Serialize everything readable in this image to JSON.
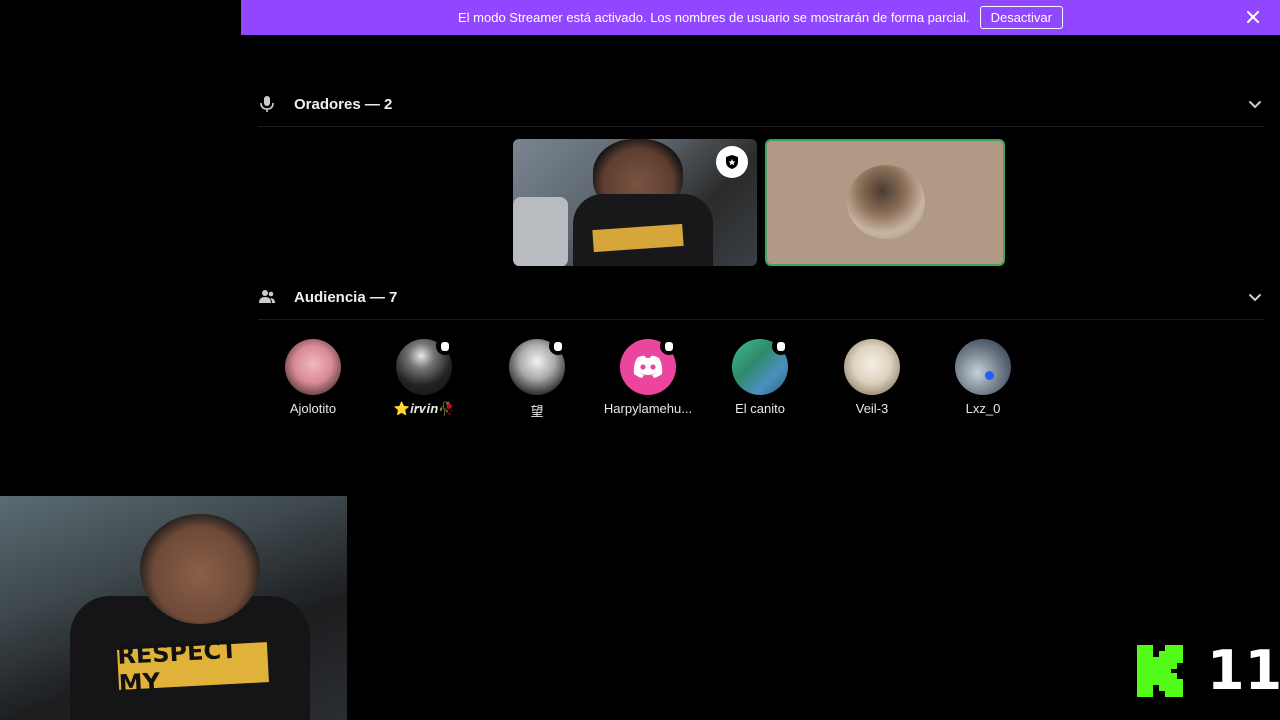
{
  "banner": {
    "text": "El modo Streamer está activado. Los nombres de usuario se mostrarán de forma parcial.",
    "button": "Desactivar",
    "close_icon": "close-icon",
    "color": "#9146ff"
  },
  "speakers": {
    "title": "Oradores — 2",
    "icon": "microphone-icon"
  },
  "audience": {
    "title": "Audiencia — 7",
    "icon": "people-icon",
    "members": [
      {
        "name": "Ajolotito",
        "hand_raised": false
      },
      {
        "name": "⭐𝒊𝒓𝒗𝒊𝒏🥀",
        "hand_raised": true
      },
      {
        "name": "望",
        "hand_raised": true
      },
      {
        "name": "Harpylamehu...",
        "hand_raised": true
      },
      {
        "name": "El canito",
        "hand_raised": true
      },
      {
        "name": "Veil-3",
        "hand_raised": false
      },
      {
        "name": "Lxz_0",
        "hand_raised": false
      }
    ]
  },
  "webcam": {
    "shirt_text": "RESPECT MY"
  },
  "kick": {
    "count": "11",
    "color": "#53fc18"
  }
}
